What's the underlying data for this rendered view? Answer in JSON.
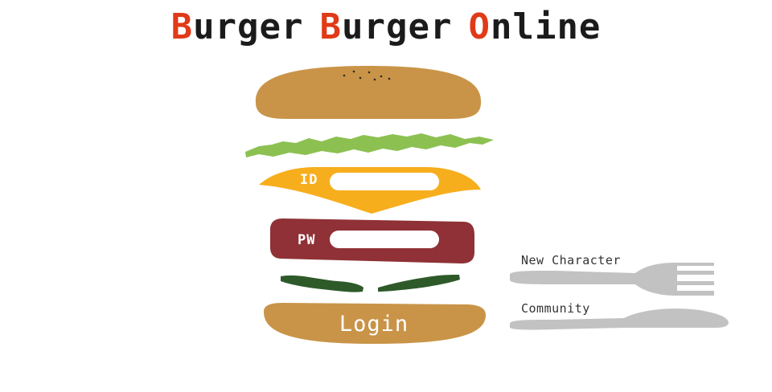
{
  "title": {
    "words": [
      {
        "cap": "B",
        "rest": "urger"
      },
      {
        "cap": "B",
        "rest": "urger"
      },
      {
        "cap": "O",
        "rest": "nline"
      }
    ]
  },
  "login_form": {
    "id_label": "ID",
    "id_value": "",
    "pw_label": "PW",
    "pw_value": "",
    "login_label": "Login"
  },
  "links": {
    "new_character": "New Character",
    "community": "Community"
  },
  "icons": {
    "bun": "bun-top-icon",
    "lettuce": "lettuce-icon",
    "cheese": "cheese-icon",
    "patty": "patty-icon",
    "pickles": "pickle-icon",
    "bottom_bun": "bun-bottom-icon",
    "fork": "fork-icon",
    "knife": "knife-icon"
  },
  "colors": {
    "title_accent": "#e03a18",
    "title_text": "#1b1b1b",
    "bun": "#c99448",
    "lettuce": "#8cc152",
    "cheese": "#f7ae1d",
    "patty": "#8f3136",
    "pickle": "#2e5a2a",
    "cutlery": "#c2c2c2"
  }
}
